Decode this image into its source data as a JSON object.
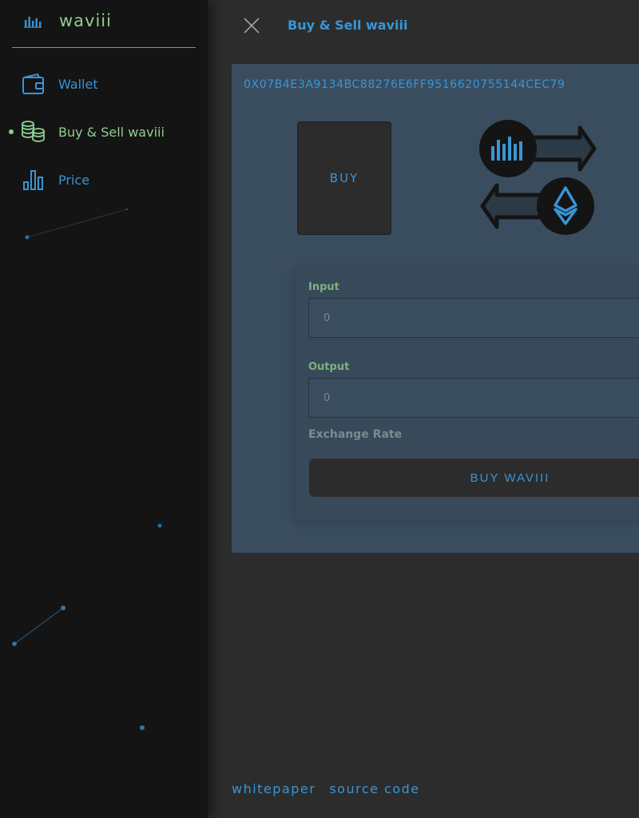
{
  "brand": {
    "name": "waviii"
  },
  "sidebar": {
    "items": [
      {
        "label": "Wallet",
        "icon": "wallet-icon"
      },
      {
        "label": "Buy & Sell waviii",
        "icon": "coins-icon",
        "active": true
      },
      {
        "label": "Price",
        "icon": "bar-chart-icon"
      }
    ]
  },
  "header": {
    "title": "Buy & Sell waviii",
    "close_icon": "close-icon"
  },
  "card": {
    "address": "0X07B4E3A9134BC88276E6FF9516620755144CEC79",
    "buy_tab_label": "buy"
  },
  "form": {
    "input_label": "Input",
    "input_placeholder": "0",
    "output_label": "Output",
    "output_placeholder": "0",
    "rate_label": "Exchange Rate",
    "submit_label": "buy waviii"
  },
  "footer": {
    "whitepaper": "whitepaper",
    "source_code": "source code"
  },
  "colors": {
    "accent_blue": "#3a95d4",
    "accent_green": "#8fce8f",
    "card_bg": "#3a4d5e",
    "sidebar_bg": "#141414"
  }
}
